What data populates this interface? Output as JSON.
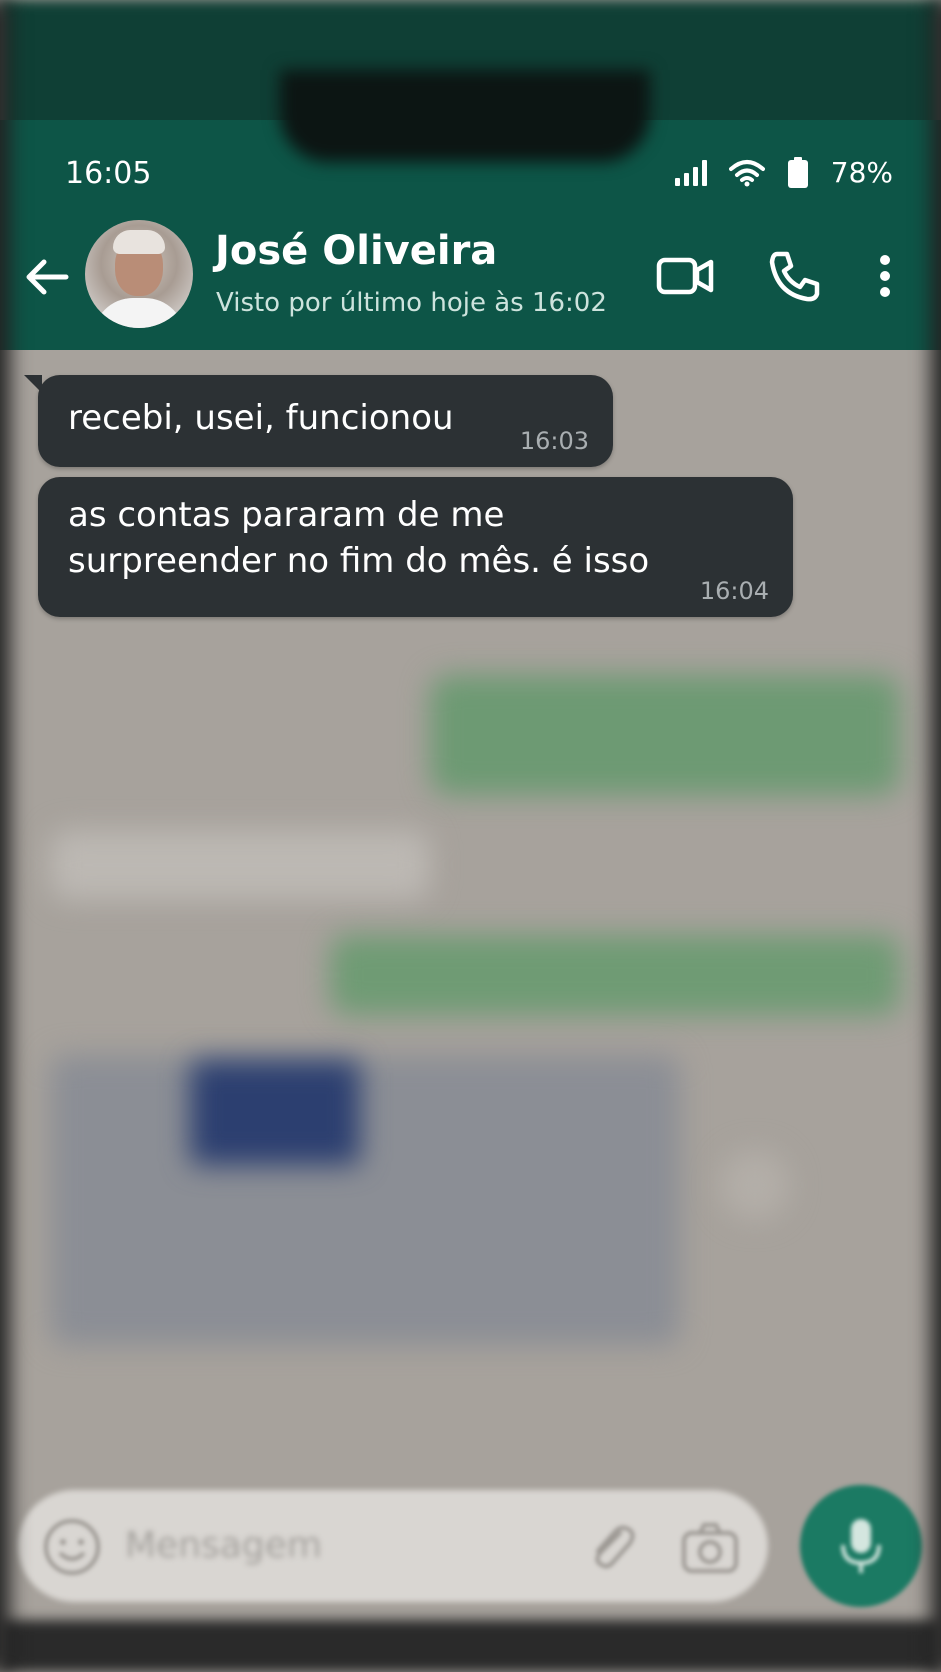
{
  "status_bar": {
    "time": "16:05",
    "battery": "78%"
  },
  "header": {
    "contact_name": "José Oliveira",
    "last_seen": "Visto por último hoje às 16:02"
  },
  "messages": [
    {
      "lines": [
        "recebi, usei, funcionou"
      ],
      "time": "16:03"
    },
    {
      "lines": [
        "as contas pararam de me",
        "surpreender no fim do mês. é isso"
      ],
      "time": "16:04"
    }
  ],
  "composer": {
    "placeholder": "Mensagem"
  },
  "colors": {
    "header": "#0d5547",
    "bubble_incoming": "#2c3134",
    "mic_button": "#1b7a63"
  }
}
